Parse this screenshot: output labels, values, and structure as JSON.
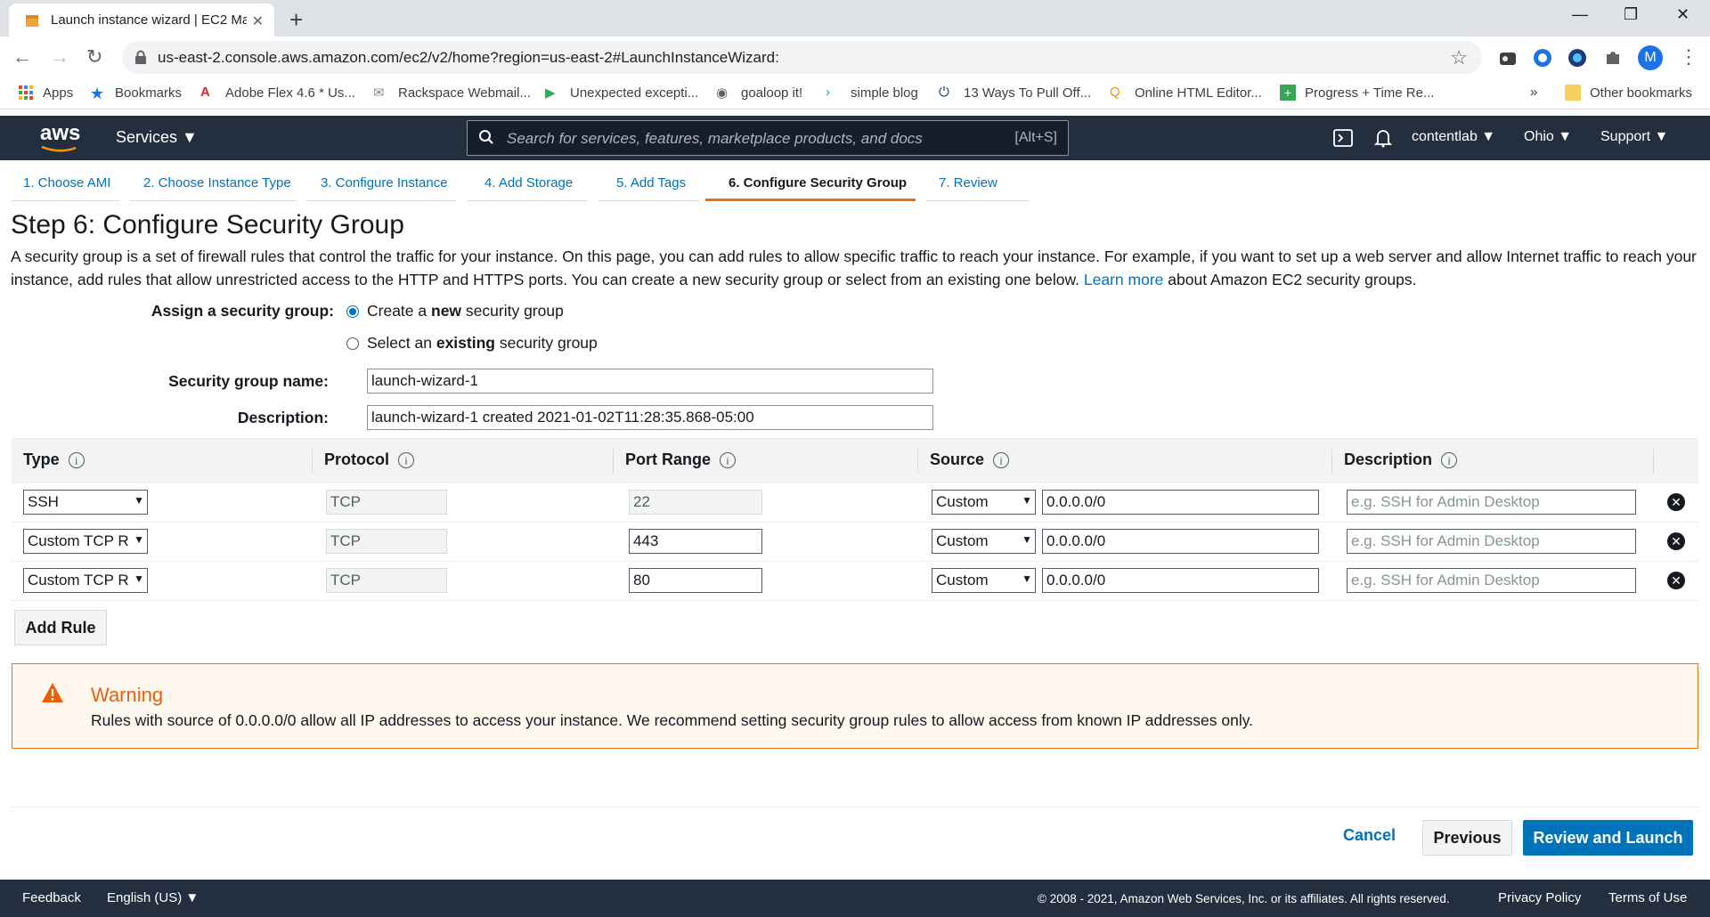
{
  "browser": {
    "tab_title": "Launch instance wizard | EC2 Ma",
    "url": "us-east-2.console.aws.amazon.com/ec2/v2/home?region=us-east-2#LaunchInstanceWizard:",
    "avatar_letter": "M",
    "bookmarks": [
      "Apps",
      "Bookmarks",
      "Adobe Flex 4.6 * Us...",
      "Rackspace Webmail...",
      "Unexpected excepti...",
      "goaloop it!",
      "simple blog",
      "13 Ways To Pull Off...",
      "Online HTML Editor...",
      "Progress + Time Re...",
      "»",
      "Other bookmarks"
    ]
  },
  "aws_nav": {
    "logo": "aws",
    "services": "Services ▼",
    "search_placeholder": "Search for services, features, marketplace products, and docs",
    "search_shortcut": "[Alt+S]",
    "account": "contentlab ▼",
    "region": "Ohio ▼",
    "support": "Support ▼"
  },
  "wizard_tabs": [
    {
      "label": "1. Choose AMI"
    },
    {
      "label": "2. Choose Instance Type"
    },
    {
      "label": "3. Configure Instance"
    },
    {
      "label": "4. Add Storage"
    },
    {
      "label": "5. Add Tags"
    },
    {
      "label": "6. Configure Security Group"
    },
    {
      "label": "7. Review"
    }
  ],
  "page": {
    "title": "Step 6: Configure Security Group",
    "intro_1": "A security group is a set of firewall rules that control the traffic for your instance. On this page, you can add rules to allow specific traffic to reach your instance. For example, if you want to set up a web server and allow Internet traffic to reach your instance, add rules that allow unrestricted access to the HTTP and HTTPS ports. You can create a new security group or select from an existing one below.",
    "learn_more": "Learn more",
    "intro_2": "about Amazon EC2 security groups."
  },
  "form": {
    "assign_label": "Assign a security group:",
    "option_new_pre": "Create a",
    "option_new_bold": "new",
    "option_new_post": "security group",
    "option_existing_pre": "Select an",
    "option_existing_bold": "existing",
    "option_existing_post": "security group",
    "name_label": "Security group name:",
    "name_value": "launch-wizard-1",
    "desc_label": "Description:",
    "desc_value": "launch-wizard-1 created 2021-01-02T11:28:35.868-05:00"
  },
  "table": {
    "headers": [
      "Type",
      "Protocol",
      "Port Range",
      "Source",
      "Description"
    ],
    "rows": [
      {
        "type": "SSH",
        "protocol": "TCP",
        "port": "22",
        "source_mode": "Custom",
        "source": "0.0.0.0/0",
        "desc_placeholder": "e.g. SSH for Admin Desktop"
      },
      {
        "type": "Custom TCP R",
        "protocol": "TCP",
        "port": "443",
        "source_mode": "Custom",
        "source": "0.0.0.0/0",
        "desc_placeholder": "e.g. SSH for Admin Desktop"
      },
      {
        "type": "Custom TCP R",
        "protocol": "TCP",
        "port": "80",
        "source_mode": "Custom",
        "source": "0.0.0.0/0",
        "desc_placeholder": "e.g. SSH for Admin Desktop"
      }
    ]
  },
  "add_rule": "Add Rule",
  "warning": {
    "title": "Warning",
    "body": "Rules with source of 0.0.0.0/0 allow all IP addresses to access your instance. We recommend setting security group rules to allow access from known IP addresses only."
  },
  "actions": {
    "cancel": "Cancel",
    "previous": "Previous",
    "review": "Review and Launch"
  },
  "footer": {
    "feedback": "Feedback",
    "language": "English (US) ▼",
    "copyright": "© 2008 - 2021, Amazon Web Services, Inc. or its affiliates. All rights reserved.",
    "privacy": "Privacy Policy",
    "terms": "Terms of Use"
  },
  "colors": {
    "accent": "#0073bb",
    "active_tab": "#ec7211",
    "nav_bg": "#232f3e",
    "warning": "#eb5f07"
  }
}
